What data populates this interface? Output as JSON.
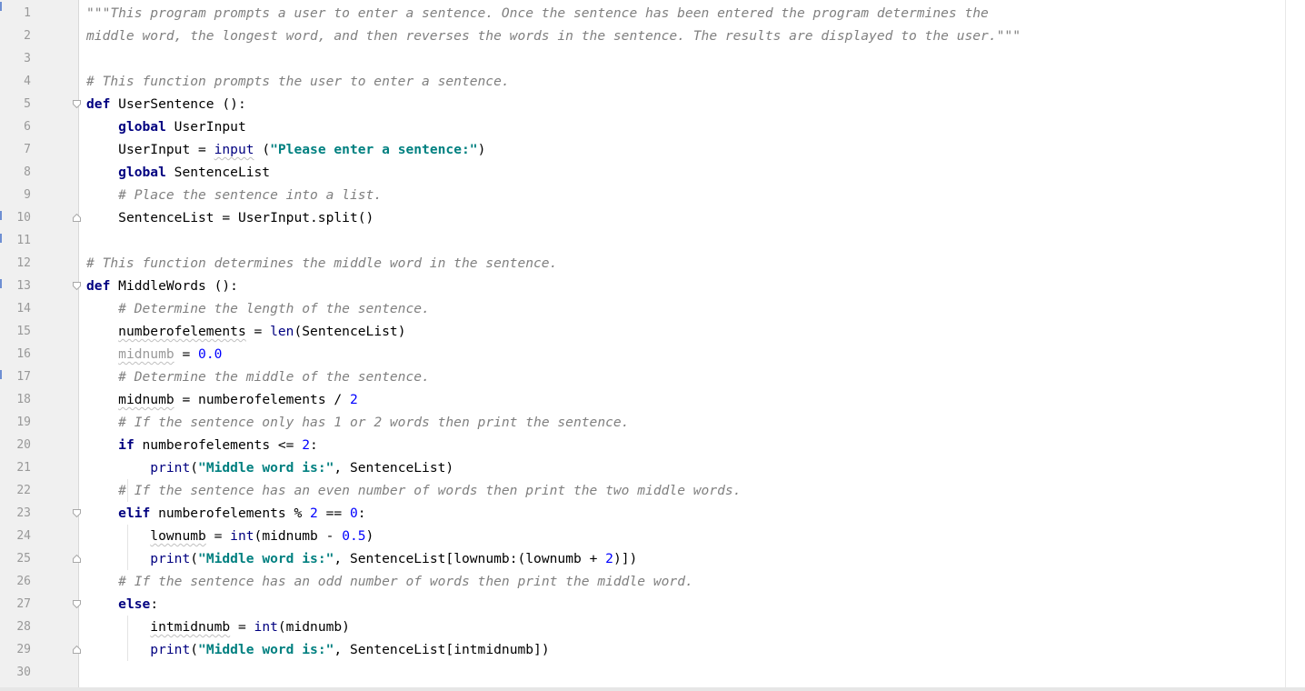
{
  "editor": {
    "line_numbers": [
      "1",
      "2",
      "3",
      "4",
      "5",
      "6",
      "7",
      "8",
      "9",
      "10",
      "11",
      "12",
      "13",
      "14",
      "15",
      "16",
      "17",
      "18",
      "19",
      "20",
      "21",
      "22",
      "23",
      "24",
      "25",
      "26",
      "27",
      "28",
      "29",
      "30"
    ]
  },
  "code": {
    "l1_doc": "\"\"\"This program prompts a user to enter a sentence. Once the sentence has been entered the program determines the",
    "l2_doc": "middle word, the longest word, and then reverses the words in the sentence. The results are displayed to the user.\"\"\"",
    "l4_comment": "# This function prompts the user to enter a sentence.",
    "kw_def": "def",
    "kw_global": "global",
    "kw_if": "if",
    "kw_elif": "elif",
    "kw_else": "else",
    "fn_user_sentence": "UserSentence",
    "fn_middle_words": "MiddleWords",
    "parens_colon": " ():",
    "l6_rest": " UserInput",
    "l7_lhs": "UserInput = ",
    "l7_builtin": "input",
    "l7_open": " (",
    "l7_str": "\"Please enter a sentence:\"",
    "l7_close": ")",
    "l8_rest": " SentenceList",
    "l9_comment": "# Place the sentence into a list.",
    "l10_code": "SentenceList = UserInput.split()",
    "l12_comment": "# This function determines the middle word in the sentence.",
    "l14_comment": "# Determine the length of the sentence.",
    "l15_lhs": "numberofelements",
    "l15_eq": " = ",
    "l15_builtin": "len",
    "l15_rest": "(SentenceList)",
    "l16_var": "midnumb",
    "l16_eq": " = ",
    "l16_num": "0.0",
    "l17_comment": "# Determine the middle of the sentence.",
    "l18_var": "midnumb",
    "l18_rest": " = numberofelements / ",
    "l18_num": "2",
    "l19_comment": "# If the sentence only has 1 or 2 words then print the sentence.",
    "l20_rest": " numberofelements <= ",
    "l20_num": "2",
    "colon": ":",
    "print": "print",
    "paren_open": "(",
    "str_middle": "\"Middle word is:\"",
    "l21_rest": ", SentenceList)",
    "l22_comment": "# If the sentence has an even number of words then print the two middle words.",
    "l23_rest": " numberofelements % ",
    "l23_num1": "2",
    "l23_eqeq": " == ",
    "l23_num2": "0",
    "l24_var": "lownumb",
    "l24_eq": " = ",
    "l24_builtin": "int",
    "l24_mid": "(midnumb - ",
    "l24_num": "0.5",
    "l24_close": ")",
    "l25_mid": ", SentenceList[lownumb:(lownumb + ",
    "l25_num": "2",
    "l25_close": ")])",
    "l26_comment": "# If the sentence has an odd number of words then print the middle word.",
    "l28_var": "intmidnumb",
    "l28_eq": " = ",
    "l28_builtin": "int",
    "l28_rest": "(midnumb)",
    "l29_rest": ", SentenceList[intmidnumb])"
  },
  "colors": {
    "keyword": "#000080",
    "string": "#008080",
    "number": "#0000ff",
    "comment": "#808080",
    "gutter_bg": "#f0f0f0",
    "change_marker": "#6e8fd3"
  }
}
